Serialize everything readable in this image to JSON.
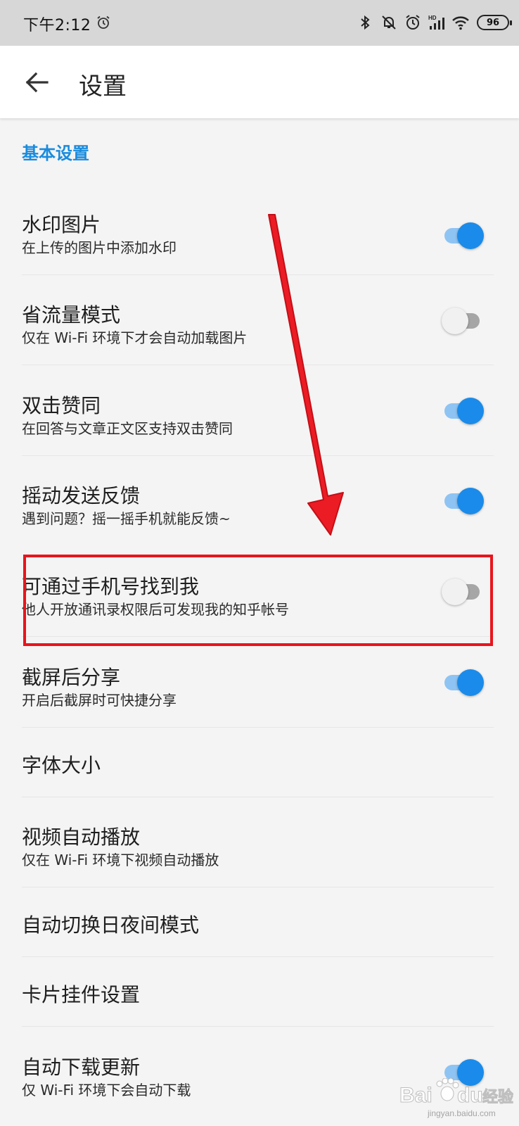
{
  "status_bar": {
    "time": "下午2:12",
    "battery": "96",
    "icons": [
      "alarm-icon",
      "bluetooth-icon",
      "mute-icon",
      "alarm-icon",
      "hd-signal-icon",
      "wifi-icon",
      "battery-icon"
    ]
  },
  "app_bar": {
    "title": "设置",
    "back_icon": "back-arrow-icon"
  },
  "section": {
    "title": "基本设置"
  },
  "settings": [
    {
      "title": "水印图片",
      "subtitle": "在上传的图片中添加水印",
      "toggle": "on"
    },
    {
      "title": "省流量模式",
      "subtitle": "仅在 Wi-Fi 环境下才会自动加载图片",
      "toggle": "off"
    },
    {
      "title": "双击赞同",
      "subtitle": "在回答与文章正文区支持双击赞同",
      "toggle": "on"
    },
    {
      "title": "摇动发送反馈",
      "subtitle": "遇到问题？摇一摇手机就能反馈~",
      "toggle": "on"
    },
    {
      "title": "可通过手机号找到我",
      "subtitle": "他人开放通讯录权限后可发现我的知乎帐号",
      "toggle": "off"
    },
    {
      "title": "截屏后分享",
      "subtitle": "开启后截屏时可快捷分享",
      "toggle": "on"
    },
    {
      "title": "字体大小"
    },
    {
      "title": "视频自动播放",
      "subtitle": "仅在 Wi-Fi 环境下视频自动播放"
    },
    {
      "title": "自动切换日夜间模式"
    },
    {
      "title": "卡片挂件设置"
    },
    {
      "title": "自动下载更新",
      "subtitle": "仅 Wi-Fi 环境下会自动下载",
      "toggle": "on"
    }
  ],
  "colors": {
    "accent": "#1a8bea",
    "annotation": "#e9141c",
    "section_header": "#1a8bdd"
  },
  "watermark": {
    "brand": "Baidu经验",
    "url": "jingyan.baidu.com"
  }
}
